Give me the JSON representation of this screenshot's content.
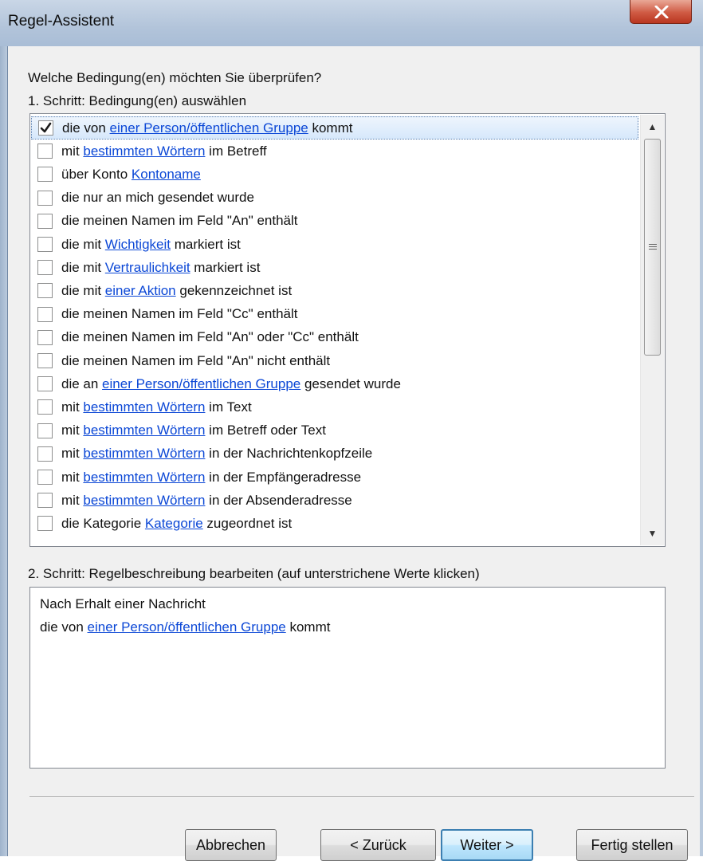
{
  "window": {
    "title": "Regel-Assistent",
    "close_label": "X"
  },
  "step_question": "Welche Bedingung(en) möchten Sie überprüfen?",
  "step1_label": "1. Schritt: Bedingung(en) auswählen",
  "conditions": [
    {
      "checked": true,
      "parts": [
        [
          "die von ",
          false
        ],
        [
          "einer Person/öffentlichen Gruppe",
          true
        ],
        [
          " kommt",
          false
        ]
      ]
    },
    {
      "checked": false,
      "parts": [
        [
          "mit ",
          false
        ],
        [
          "bestimmten Wörtern",
          true
        ],
        [
          " im Betreff",
          false
        ]
      ]
    },
    {
      "checked": false,
      "parts": [
        [
          "über Konto ",
          false
        ],
        [
          "Kontoname",
          true
        ]
      ]
    },
    {
      "checked": false,
      "parts": [
        [
          "die nur an mich gesendet wurde",
          false
        ]
      ]
    },
    {
      "checked": false,
      "parts": [
        [
          "die meinen Namen im Feld \"An\" enthält",
          false
        ]
      ]
    },
    {
      "checked": false,
      "parts": [
        [
          "die mit ",
          false
        ],
        [
          "Wichtigkeit",
          true
        ],
        [
          " markiert ist",
          false
        ]
      ]
    },
    {
      "checked": false,
      "parts": [
        [
          "die mit ",
          false
        ],
        [
          "Vertraulichkeit",
          true
        ],
        [
          " markiert ist",
          false
        ]
      ]
    },
    {
      "checked": false,
      "parts": [
        [
          "die mit ",
          false
        ],
        [
          "einer Aktion",
          true
        ],
        [
          " gekennzeichnet ist",
          false
        ]
      ]
    },
    {
      "checked": false,
      "parts": [
        [
          "die meinen Namen im Feld \"Cc\" enthält",
          false
        ]
      ]
    },
    {
      "checked": false,
      "parts": [
        [
          "die meinen Namen im Feld \"An\" oder \"Cc\" enthält",
          false
        ]
      ]
    },
    {
      "checked": false,
      "parts": [
        [
          "die meinen Namen im Feld \"An\" nicht enthält",
          false
        ]
      ]
    },
    {
      "checked": false,
      "parts": [
        [
          "die an ",
          false
        ],
        [
          "einer Person/öffentlichen Gruppe",
          true
        ],
        [
          " gesendet wurde",
          false
        ]
      ]
    },
    {
      "checked": false,
      "parts": [
        [
          "mit ",
          false
        ],
        [
          "bestimmten Wörtern",
          true
        ],
        [
          " im Text",
          false
        ]
      ]
    },
    {
      "checked": false,
      "parts": [
        [
          "mit ",
          false
        ],
        [
          "bestimmten Wörtern",
          true
        ],
        [
          " im Betreff oder Text",
          false
        ]
      ]
    },
    {
      "checked": false,
      "parts": [
        [
          "mit ",
          false
        ],
        [
          "bestimmten Wörtern",
          true
        ],
        [
          " in der Nachrichtenkopfzeile",
          false
        ]
      ]
    },
    {
      "checked": false,
      "parts": [
        [
          "mit ",
          false
        ],
        [
          "bestimmten Wörtern",
          true
        ],
        [
          " in der Empfängeradresse",
          false
        ]
      ]
    },
    {
      "checked": false,
      "parts": [
        [
          "mit ",
          false
        ],
        [
          "bestimmten Wörtern",
          true
        ],
        [
          " in der Absenderadresse",
          false
        ]
      ]
    },
    {
      "checked": false,
      "parts": [
        [
          "die Kategorie ",
          false
        ],
        [
          "Kategorie",
          true
        ],
        [
          " zugeordnet ist",
          false
        ]
      ]
    }
  ],
  "step2_label": "2. Schritt: Regelbeschreibung bearbeiten (auf unterstrichene Werte klicken)",
  "description": {
    "line1": "Nach Erhalt einer Nachricht",
    "line2_prefix": "die von ",
    "line2_link": "einer Person/öffentlichen Gruppe",
    "line2_suffix": " kommt"
  },
  "buttons": {
    "cancel": "Abbrechen",
    "back": "< Zurück",
    "next": "Weiter >",
    "finish": "Fertig stellen"
  }
}
